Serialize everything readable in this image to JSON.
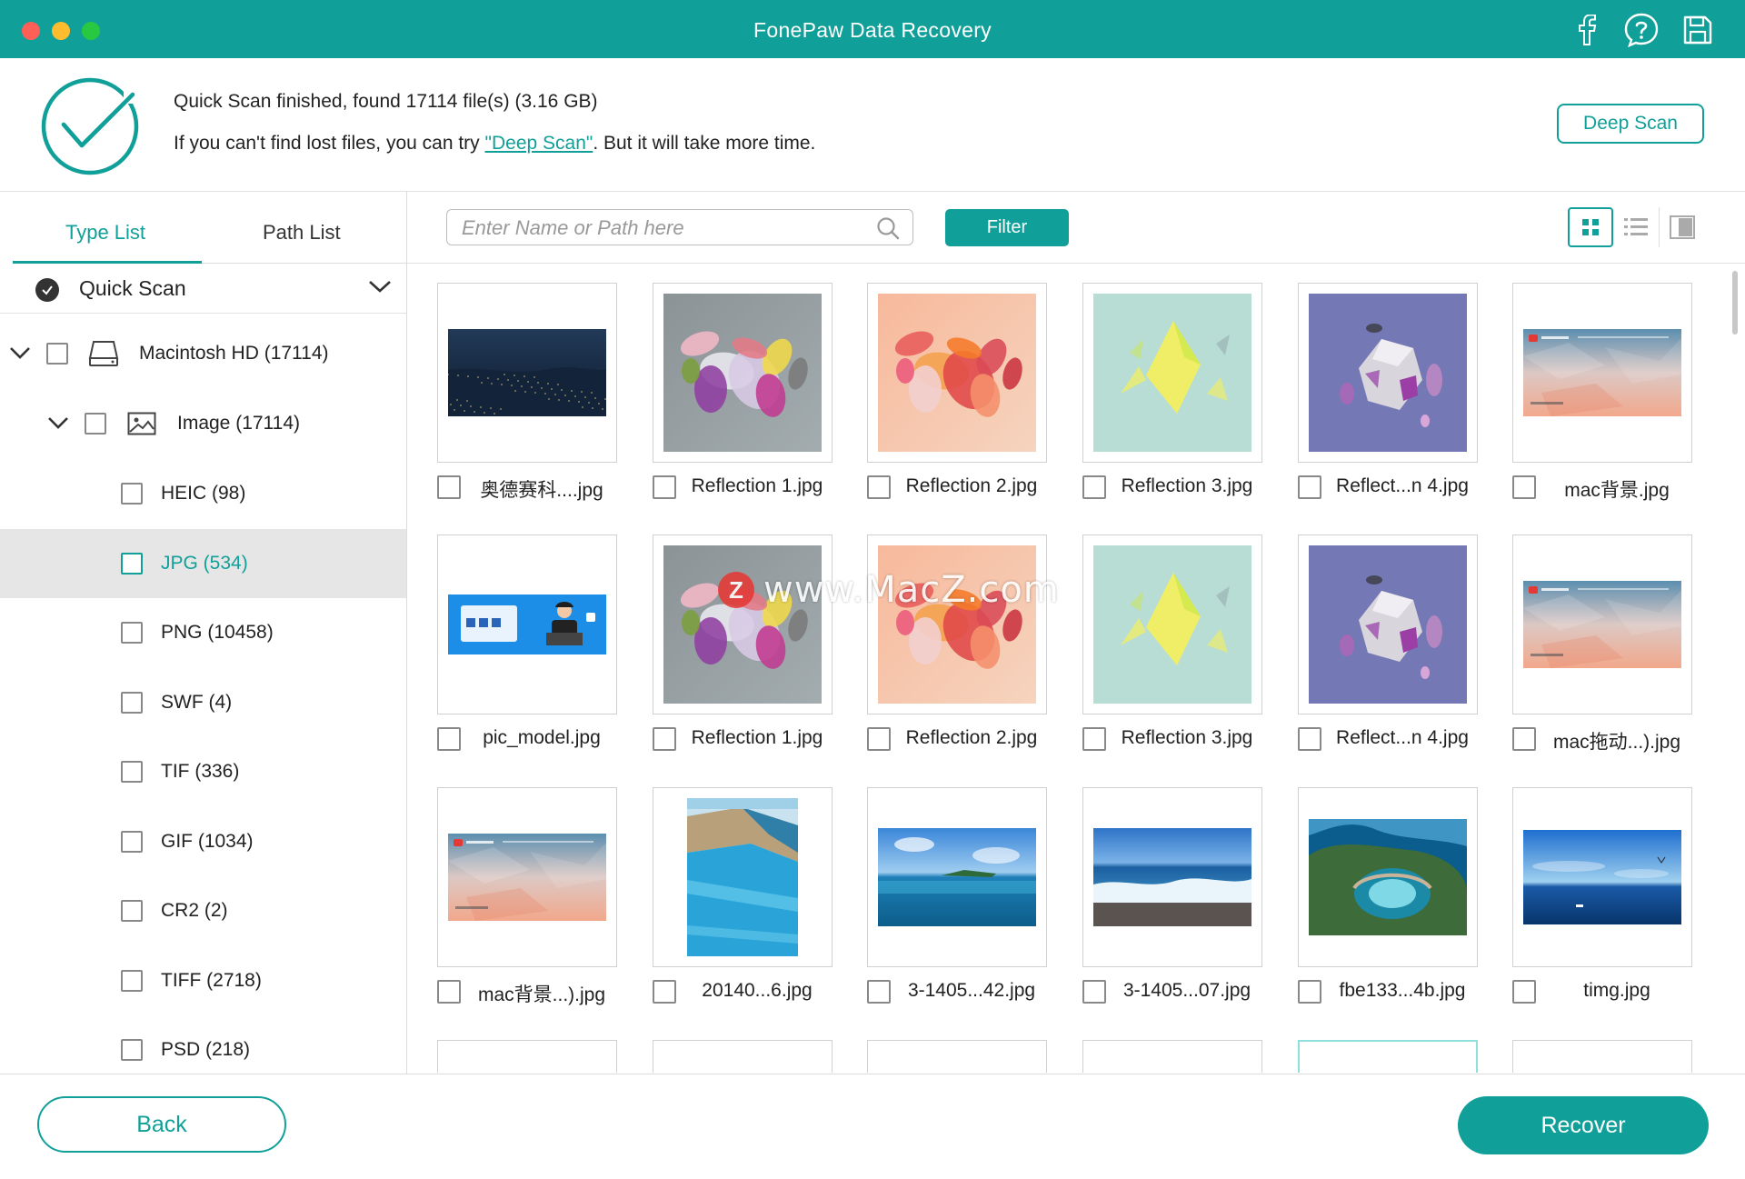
{
  "window": {
    "title": "FonePaw Data Recovery"
  },
  "colors": {
    "accent": "#11a099",
    "close": "#fe5f57",
    "minimize": "#febc2e",
    "zoom": "#28c840"
  },
  "header": {
    "status_line": "Quick Scan finished, found 17114 file(s) (3.16 GB)",
    "hint_prefix": "If you can't find lost files, you can try ",
    "hint_link": "\"Deep Scan\"",
    "hint_suffix": ". But it will take more time.",
    "deep_scan_label": "Deep Scan"
  },
  "sidebar": {
    "tabs": [
      {
        "label": "Type List",
        "active": true
      },
      {
        "label": "Path List",
        "active": false
      }
    ],
    "scan_mode": "Quick Scan",
    "drive": "Macintosh HD (17114)",
    "category": "Image (17114)",
    "types": [
      {
        "label": "HEIC (98)",
        "selected": false
      },
      {
        "label": "JPG (534)",
        "selected": true
      },
      {
        "label": "PNG (10458)",
        "selected": false
      },
      {
        "label": "SWF (4)",
        "selected": false
      },
      {
        "label": "TIF (336)",
        "selected": false
      },
      {
        "label": "GIF (1034)",
        "selected": false
      },
      {
        "label": "CR2 (2)",
        "selected": false
      },
      {
        "label": "TIFF (2718)",
        "selected": false
      },
      {
        "label": "PSD (218)",
        "selected": false
      }
    ]
  },
  "toolbar": {
    "search_placeholder": "Enter Name or Path here",
    "filter_label": "Filter",
    "active_view": "grid"
  },
  "files": [
    {
      "name": "奥德赛科....jpg",
      "thumb": "night-city"
    },
    {
      "name": "Reflection 1.jpg",
      "thumb": "reflection-gray"
    },
    {
      "name": "Reflection 2.jpg",
      "thumb": "reflection-peach"
    },
    {
      "name": "Reflection 3.jpg",
      "thumb": "reflection-mint"
    },
    {
      "name": "Reflect...n 4.jpg",
      "thumb": "reflection-purple"
    },
    {
      "name": "mac背景.jpg",
      "thumb": "mac-banner"
    },
    {
      "name": "pic_model.jpg",
      "thumb": "blue-banner"
    },
    {
      "name": "Reflection 1.jpg",
      "thumb": "reflection-gray"
    },
    {
      "name": "Reflection 2.jpg",
      "thumb": "reflection-peach"
    },
    {
      "name": "Reflection 3.jpg",
      "thumb": "reflection-mint"
    },
    {
      "name": "Reflect...n 4.jpg",
      "thumb": "reflection-purple"
    },
    {
      "name": "mac拖动...).jpg",
      "thumb": "mac-banner"
    },
    {
      "name": "mac背景...).jpg",
      "thumb": "mac-banner"
    },
    {
      "name": "20140...6.jpg",
      "thumb": "pool"
    },
    {
      "name": "3-1405...42.jpg",
      "thumb": "ocean-island"
    },
    {
      "name": "3-1405...07.jpg",
      "thumb": "ocean-wave"
    },
    {
      "name": "fbe133...4b.jpg",
      "thumb": "coast-arch"
    },
    {
      "name": "timg.jpg",
      "thumb": "ocean-boat"
    }
  ],
  "watermark": {
    "badge": "Z",
    "text": "www.MacZ.com"
  },
  "footer": {
    "back_label": "Back",
    "recover_label": "Recover"
  }
}
